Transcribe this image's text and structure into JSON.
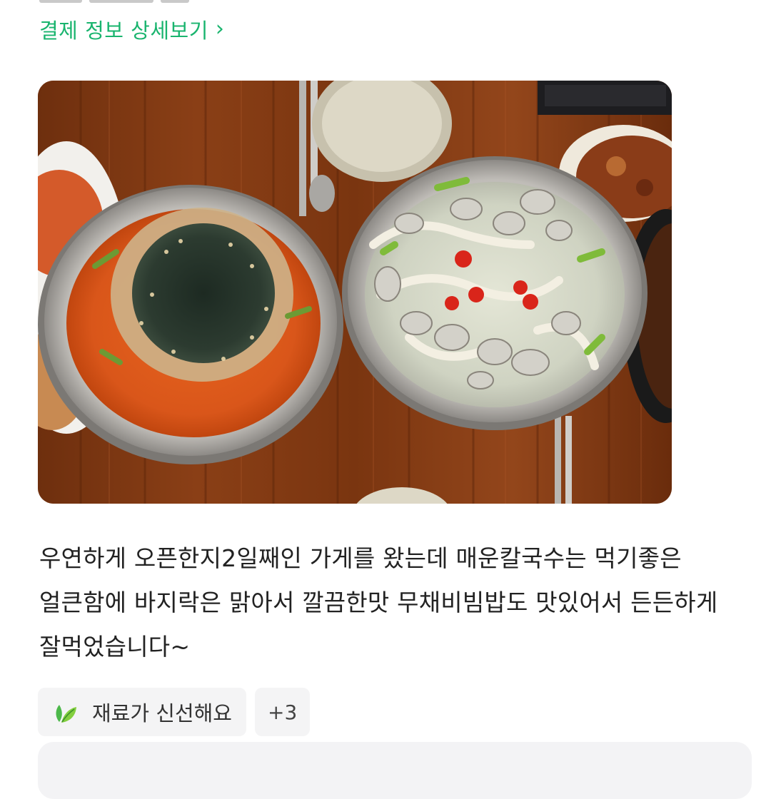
{
  "payment": {
    "link_label": "결제 정보 상세보기",
    "chevron": "›"
  },
  "photo": {
    "icon": "food-photo"
  },
  "review": {
    "text": "우연하게 오픈한지2일째인 가게를 왔는데 매운칼국수는 먹기좋은 얼큰함에 바지락은 맑아서 깔끔한맛 무채비빔밥도 맛있어서 든든하게 잘먹었습니다~"
  },
  "tags": {
    "primary_icon": "leaf-icon",
    "primary_label": "재료가 신선해요",
    "more_label": "+3"
  },
  "colors": {
    "accent_green": "#19b46e",
    "tag_bg": "#f4f4f5",
    "text_main": "#222222"
  }
}
